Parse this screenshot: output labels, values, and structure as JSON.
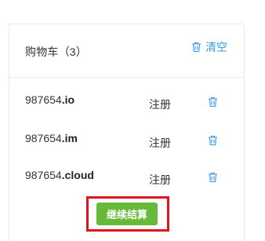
{
  "cart": {
    "title": "购物车（3）",
    "clear_label": "清空",
    "items": [
      {
        "name": "987654",
        "tld": ".io",
        "action": "注册"
      },
      {
        "name": "987654",
        "tld": ".im",
        "action": "注册"
      },
      {
        "name": "987654",
        "tld": ".cloud",
        "action": "注册"
      }
    ],
    "checkout_label": "继续结算"
  },
  "colors": {
    "accent_blue": "#3b97e3",
    "button_green": "#68b83a",
    "highlight_red": "#e0141e"
  }
}
